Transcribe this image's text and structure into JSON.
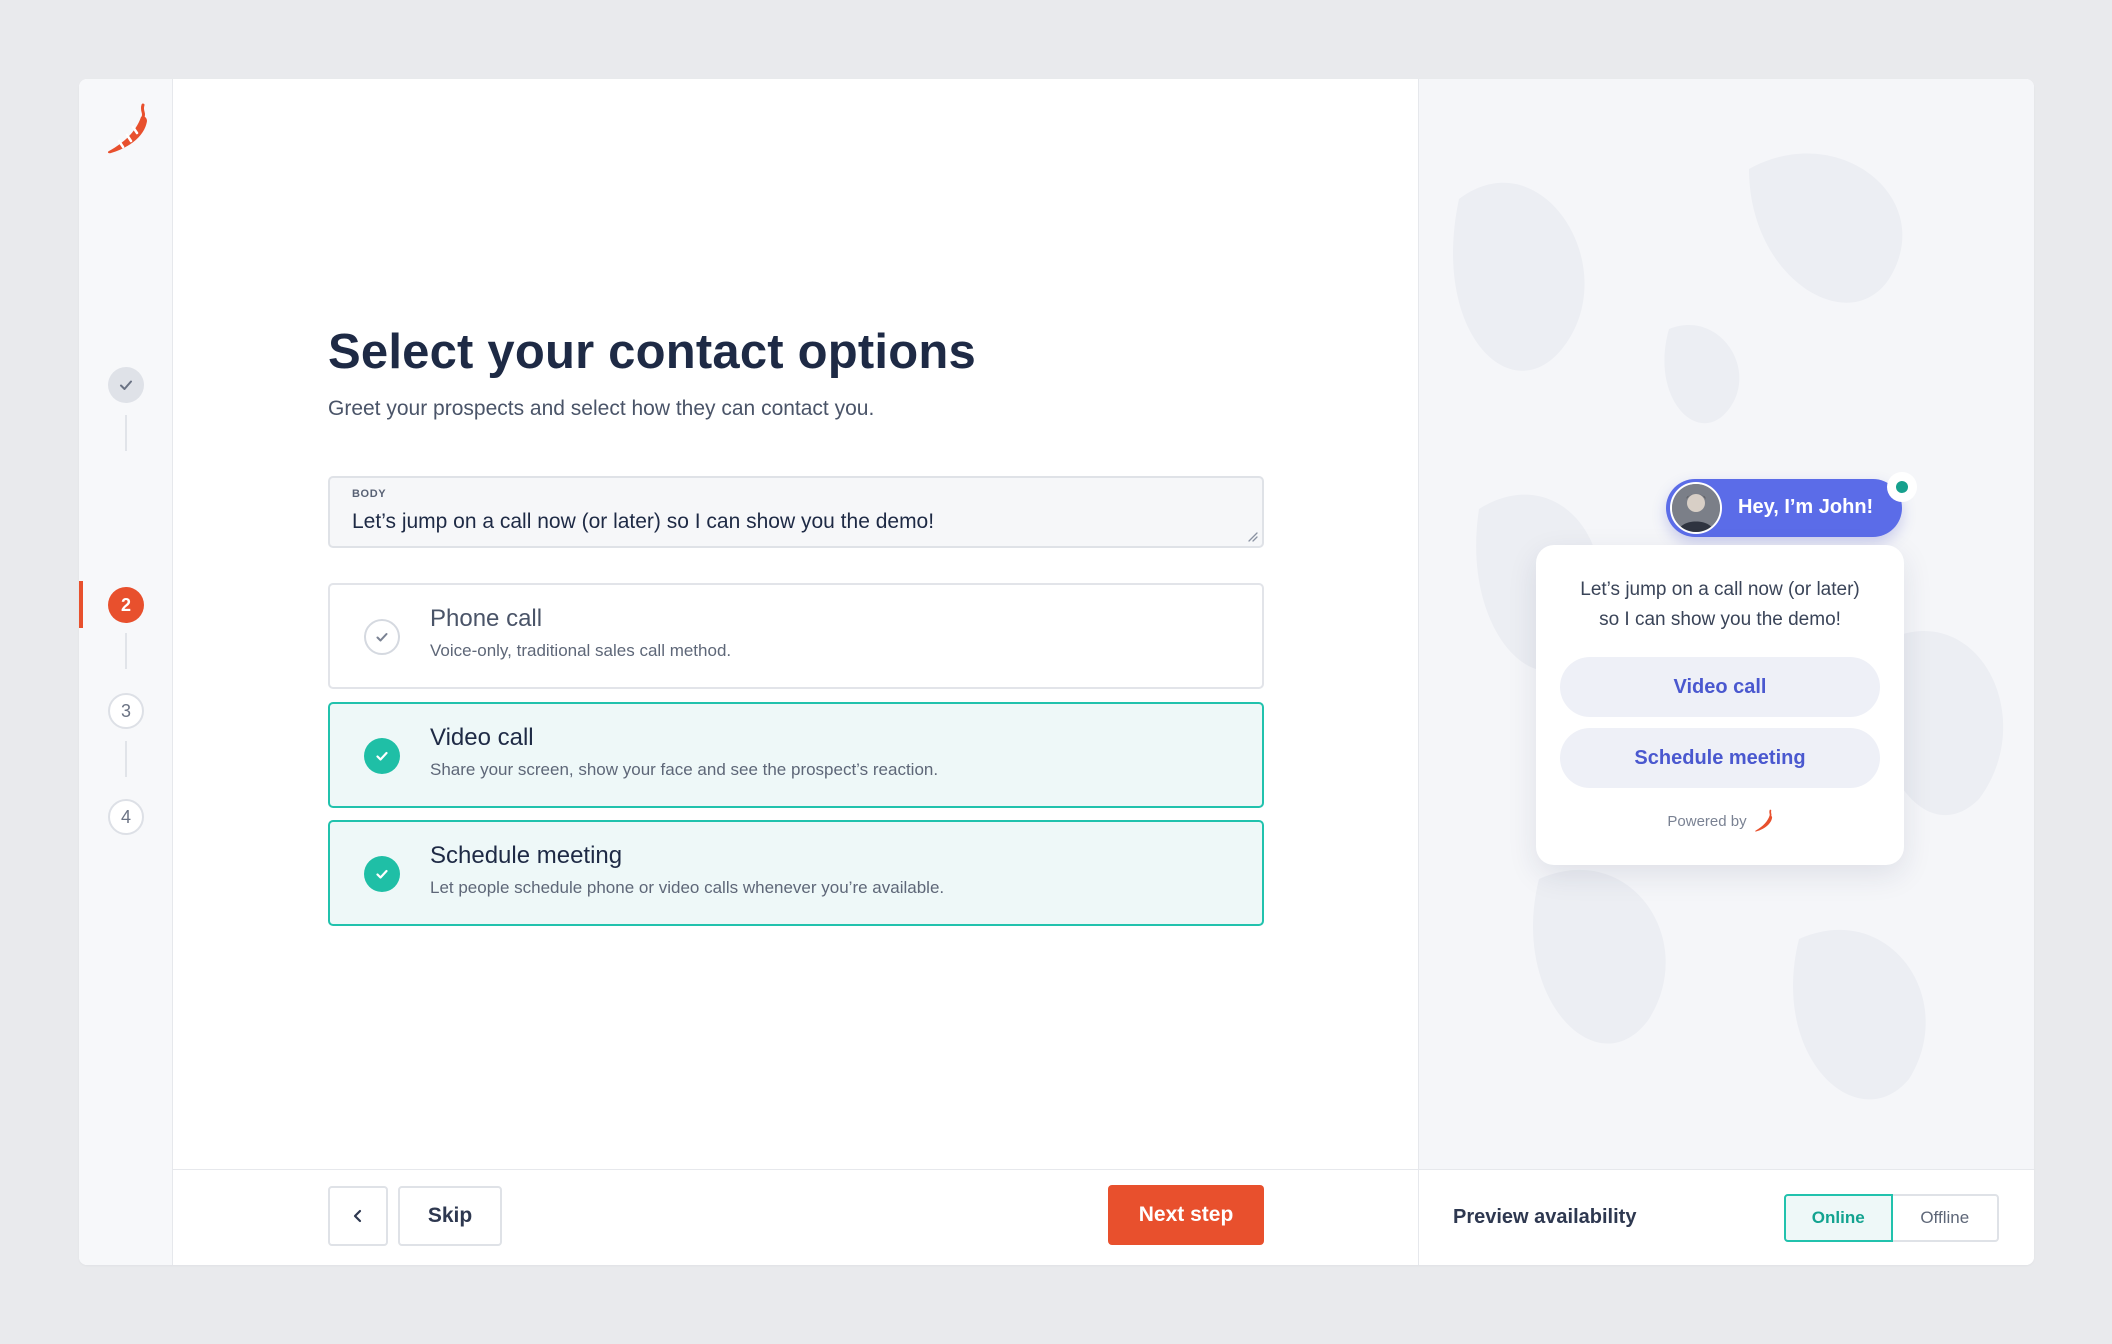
{
  "steps": [
    {
      "label": "✓",
      "state": "done"
    },
    {
      "label": "2",
      "state": "active"
    },
    {
      "label": "3",
      "state": "todo"
    },
    {
      "label": "4",
      "state": "todo"
    }
  ],
  "main": {
    "title": "Select your contact options",
    "subtitle": "Greet your prospects and select how they can contact you.",
    "body_field": {
      "label": "BODY",
      "value": "Let’s jump on a call now (or later) so I can show you the demo!"
    },
    "options": [
      {
        "title": "Phone call",
        "description": "Voice-only, traditional sales call method.",
        "selected": false
      },
      {
        "title": "Video call",
        "description": "Share your screen, show your face and see the prospect’s reaction.",
        "selected": true
      },
      {
        "title": "Schedule meeting",
        "description": "Let people schedule phone or video calls whenever you’re available.",
        "selected": true
      }
    ]
  },
  "footer": {
    "skip_label": "Skip",
    "next_label": "Next step"
  },
  "preview": {
    "greeting": "Hey, I’m John!",
    "message_line1": "Let’s jump on a call now (or later)",
    "message_line2": "so I can show you the demo!",
    "buttons": [
      "Video call",
      "Schedule meeting"
    ],
    "powered_by": "Powered by",
    "availability_label": "Preview availability",
    "availability_options": [
      "Online",
      "Offline"
    ],
    "availability_selected": "Online"
  },
  "colors": {
    "brand": "#e8502d",
    "accent_teal": "#21c2ad",
    "preview_blue": "#5b6ce8"
  }
}
